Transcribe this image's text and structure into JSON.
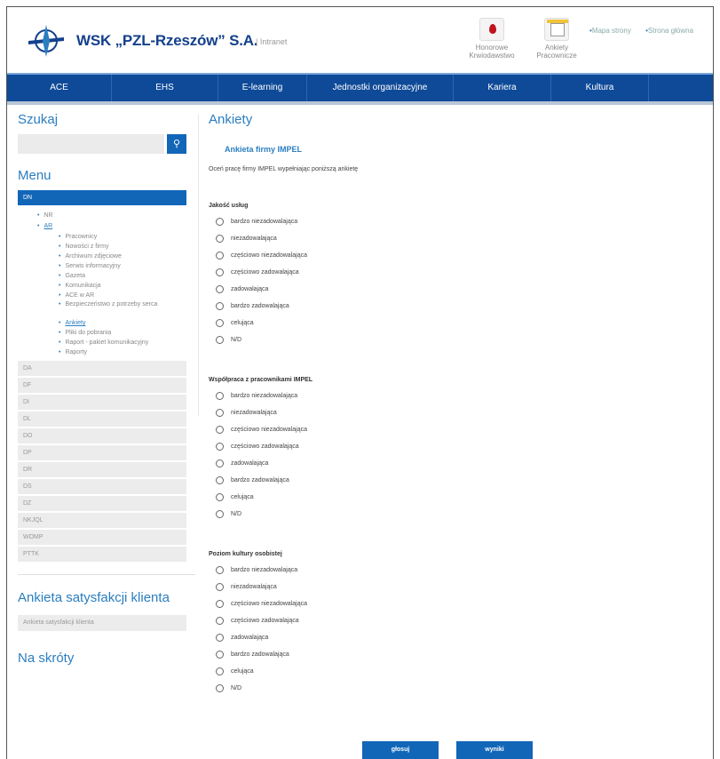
{
  "header": {
    "brand": "WSK „PZL-Rzeszów” S.A.",
    "intranet": "| Intranet",
    "quick_links": [
      {
        "label": "Honorowe Krwiodawstwo",
        "icon": "blood-drop-icon"
      },
      {
        "label": "Ankiety Pracownicze",
        "icon": "clipboard-icon"
      }
    ],
    "top_links": [
      "Mapa strony",
      "Strona główna"
    ]
  },
  "nav": {
    "items": [
      "ACE",
      "EHS",
      "E-learning",
      "Jednostki organizacyjne",
      "Kariera",
      "Kultura"
    ]
  },
  "sidebar": {
    "search_title": "Szukaj",
    "search_placeholder": "",
    "menu_title": "Menu",
    "menu_selected": "DN",
    "tree_top": [
      "NR",
      "AR"
    ],
    "tree_children": [
      "Pracownicy",
      "Nowości z firmy",
      "Archiwum zdjęciowe",
      "Serwis informacyjny",
      "Gazeta",
      "Komunikacja",
      "ACE w AR",
      "Bezpieczeństwo z potrzeby serca",
      "Ankiety",
      "Pliki do pobrania",
      "Raport - pakiet komunikacyjny",
      "Raporty"
    ],
    "categories": [
      "DA",
      "DF",
      "DI",
      "DL",
      "DO",
      "DP",
      "DR",
      "DS",
      "DZ",
      "NKJQL",
      "WOMP",
      "PTTK"
    ],
    "satisfaction_title": "Ankieta satysfakcji klienta",
    "satisfaction_link": "Ankieta satysfakcji klienta",
    "shortcuts_title": "Na skróty"
  },
  "main": {
    "title": "Ankiety",
    "survey_name": "Ankieta firmy IMPEL",
    "description": "Oceń pracę firmy IMPEL wypełniając poniższą ankietę",
    "questions": [
      {
        "title": "Jakość usług"
      },
      {
        "title": "Współpraca z pracownikami IMPEL"
      },
      {
        "title": "Poziom kultury osobistej"
      }
    ],
    "options": [
      "bardzo niezadowalająca",
      "niezadowalająca",
      "częściowo niezadowalająca",
      "częściowo zadowalająca",
      "zadowalająca",
      "bardzo zadowalająca",
      "celująca",
      "N/D"
    ],
    "buttons": {
      "vote": "głosuj",
      "results": "wyniki"
    }
  },
  "colors": {
    "nav": "#0f4a98",
    "accent": "#2a7ec0",
    "button": "#1266b8"
  }
}
